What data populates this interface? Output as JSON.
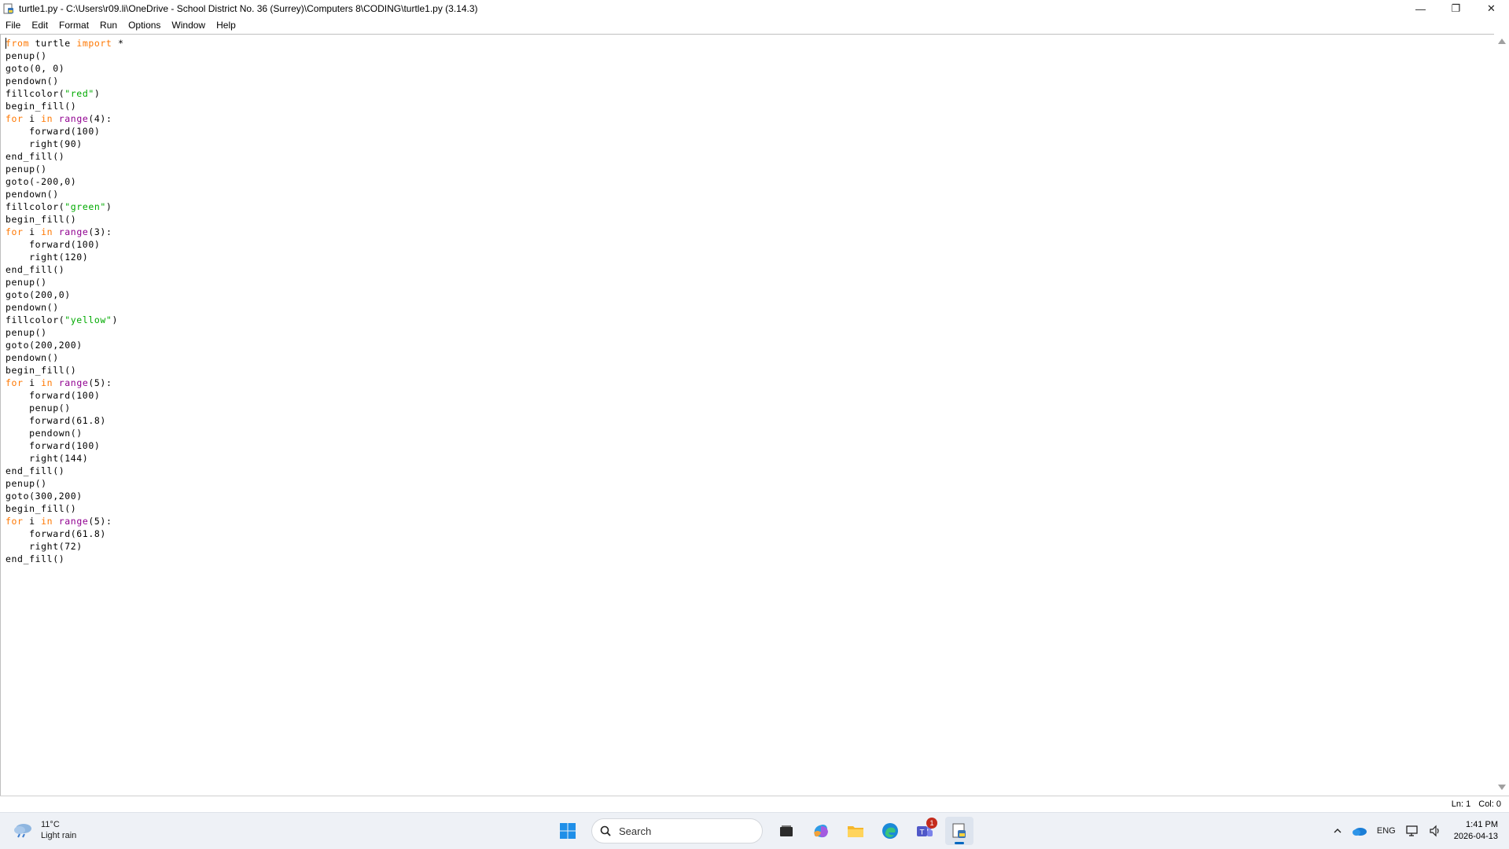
{
  "window": {
    "title": "turtle1.py - C:\\Users\\r09.li\\OneDrive - School District No. 36 (Surrey)\\Computers 8\\CODING\\turtle1.py (3.14.3)",
    "minimize": "—",
    "maximize": "❐",
    "close": "✕"
  },
  "menu": [
    "File",
    "Edit",
    "Format",
    "Run",
    "Options",
    "Window",
    "Help"
  ],
  "colors": {
    "keyword": "#ff7700",
    "builtin": "#900090",
    "string": "#00aa00"
  },
  "code_lines": [
    [
      [
        "keyword",
        "from"
      ],
      [
        "plain",
        " turtle "
      ],
      [
        "keyword",
        "import"
      ],
      [
        "plain",
        " *"
      ]
    ],
    [
      [
        "plain",
        "penup()"
      ]
    ],
    [
      [
        "plain",
        "goto(0, 0)"
      ]
    ],
    [
      [
        "plain",
        "pendown()"
      ]
    ],
    [
      [
        "plain",
        "fillcolor("
      ],
      [
        "string",
        "\"red\""
      ],
      [
        "plain",
        ")"
      ]
    ],
    [
      [
        "plain",
        "begin_fill()"
      ]
    ],
    [
      [
        "keyword",
        "for"
      ],
      [
        "plain",
        " i "
      ],
      [
        "keyword",
        "in"
      ],
      [
        "plain",
        " "
      ],
      [
        "builtin",
        "range"
      ],
      [
        "plain",
        "(4):"
      ]
    ],
    [
      [
        "plain",
        "    forward(100)"
      ]
    ],
    [
      [
        "plain",
        "    right(90)"
      ]
    ],
    [
      [
        "plain",
        "end_fill()"
      ]
    ],
    [
      [
        "plain",
        "penup()"
      ]
    ],
    [
      [
        "plain",
        "goto(-200,0)"
      ]
    ],
    [
      [
        "plain",
        "pendown()"
      ]
    ],
    [
      [
        "plain",
        "fillcolor("
      ],
      [
        "string",
        "\"green\""
      ],
      [
        "plain",
        ")"
      ]
    ],
    [
      [
        "plain",
        "begin_fill()"
      ]
    ],
    [
      [
        "keyword",
        "for"
      ],
      [
        "plain",
        " i "
      ],
      [
        "keyword",
        "in"
      ],
      [
        "plain",
        " "
      ],
      [
        "builtin",
        "range"
      ],
      [
        "plain",
        "(3):"
      ]
    ],
    [
      [
        "plain",
        "    forward(100)"
      ]
    ],
    [
      [
        "plain",
        "    right(120)"
      ]
    ],
    [
      [
        "plain",
        "end_fill()"
      ]
    ],
    [
      [
        "plain",
        "penup()"
      ]
    ],
    [
      [
        "plain",
        "goto(200,0)"
      ]
    ],
    [
      [
        "plain",
        "pendown()"
      ]
    ],
    [
      [
        "plain",
        "fillcolor("
      ],
      [
        "string",
        "\"yellow\""
      ],
      [
        "plain",
        ")"
      ]
    ],
    [
      [
        "plain",
        "penup()"
      ]
    ],
    [
      [
        "plain",
        "goto(200,200)"
      ]
    ],
    [
      [
        "plain",
        "pendown()"
      ]
    ],
    [
      [
        "plain",
        "begin_fill()"
      ]
    ],
    [
      [
        "keyword",
        "for"
      ],
      [
        "plain",
        " i "
      ],
      [
        "keyword",
        "in"
      ],
      [
        "plain",
        " "
      ],
      [
        "builtin",
        "range"
      ],
      [
        "plain",
        "(5):"
      ]
    ],
    [
      [
        "plain",
        "    forward(100)"
      ]
    ],
    [
      [
        "plain",
        "    penup()"
      ]
    ],
    [
      [
        "plain",
        "    forward(61.8)"
      ]
    ],
    [
      [
        "plain",
        "    pendown()"
      ]
    ],
    [
      [
        "plain",
        "    forward(100)"
      ]
    ],
    [
      [
        "plain",
        "    right(144)"
      ]
    ],
    [
      [
        "plain",
        "end_fill()"
      ]
    ],
    [
      [
        "plain",
        "penup()"
      ]
    ],
    [
      [
        "plain",
        "goto(300,200)"
      ]
    ],
    [
      [
        "plain",
        "begin_fill()"
      ]
    ],
    [
      [
        "keyword",
        "for"
      ],
      [
        "plain",
        " i "
      ],
      [
        "keyword",
        "in"
      ],
      [
        "plain",
        " "
      ],
      [
        "builtin",
        "range"
      ],
      [
        "plain",
        "(5):"
      ]
    ],
    [
      [
        "plain",
        "    forward(61.8)"
      ]
    ],
    [
      [
        "plain",
        "    right(72)"
      ]
    ],
    [
      [
        "plain",
        "end_fill()"
      ]
    ]
  ],
  "status": {
    "line": "Ln: 1",
    "col": "Col: 0"
  },
  "taskbar": {
    "weather_temp": "11°C",
    "weather_desc": "Light rain",
    "search_label": "Search",
    "teams_badge": "1",
    "language": "ENG",
    "time": "1:41 PM",
    "date": "2026-04-13",
    "icons": [
      "windows-start-icon",
      "search-icon",
      "task-view-icon",
      "m365-copilot-icon",
      "file-explorer-icon",
      "edge-icon",
      "teams-icon",
      "python-idle-icon"
    ]
  }
}
